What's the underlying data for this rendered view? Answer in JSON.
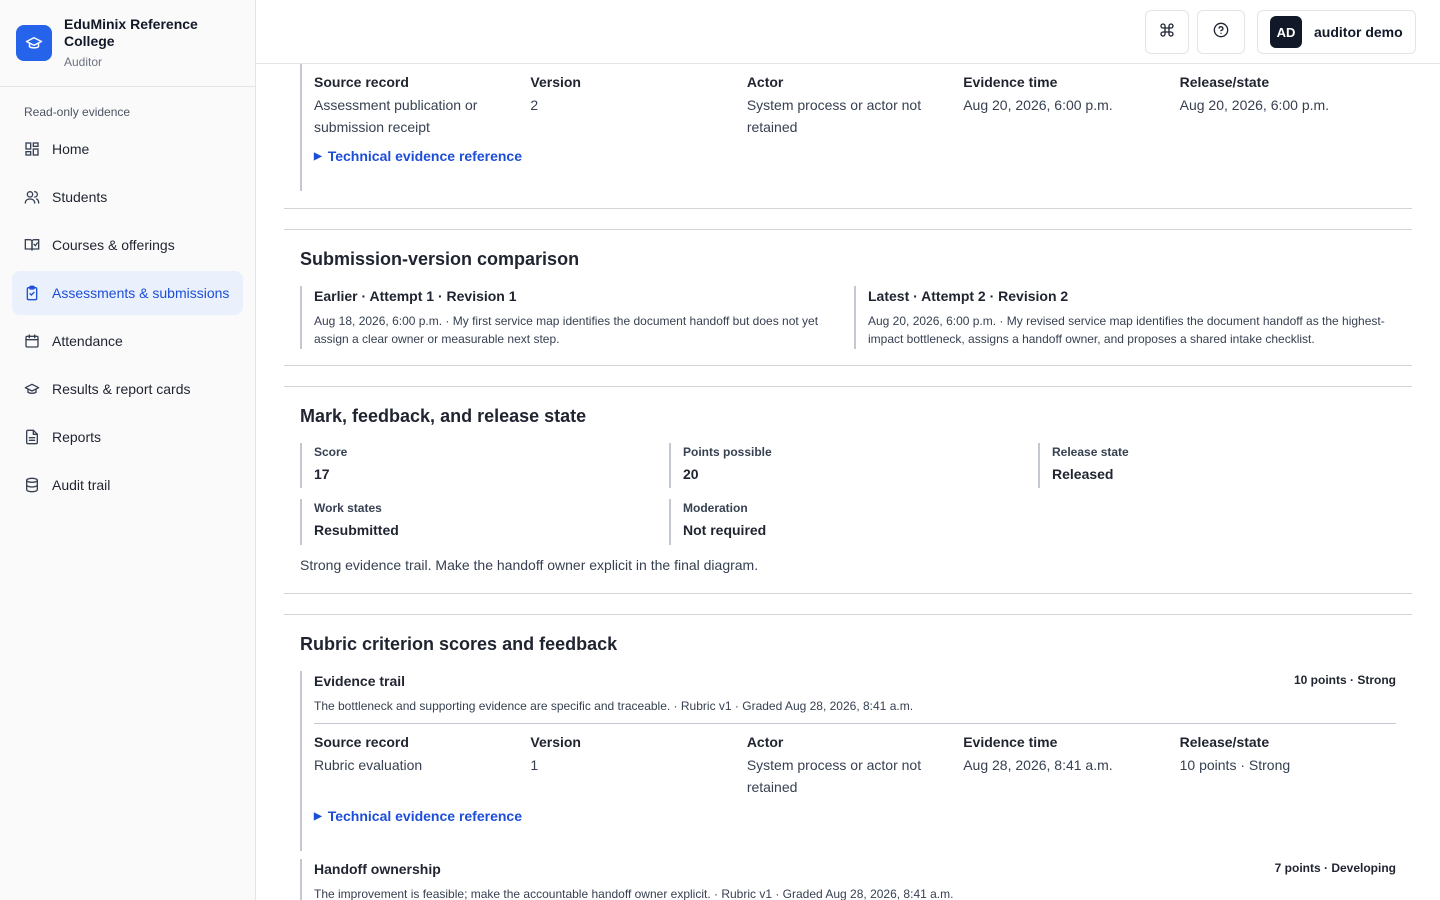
{
  "brand": {
    "name": "EduMinix Reference College",
    "role": "Auditor"
  },
  "sidebar": {
    "heading": "Read-only evidence",
    "items": [
      {
        "label": "Home",
        "icon": "dashboard-icon"
      },
      {
        "label": "Students",
        "icon": "users-icon"
      },
      {
        "label": "Courses & offerings",
        "icon": "book-check-icon"
      },
      {
        "label": "Assessments & submissions",
        "icon": "clipboard-check-icon",
        "active": true
      },
      {
        "label": "Attendance",
        "icon": "calendar-icon"
      },
      {
        "label": "Results & report cards",
        "icon": "graduation-cap-icon"
      },
      {
        "label": "Reports",
        "icon": "file-text-icon"
      },
      {
        "label": "Audit trail",
        "icon": "database-icon"
      }
    ]
  },
  "header": {
    "command_icon": "command-icon",
    "help_icon": "help-circle-icon",
    "user": {
      "initials": "AD",
      "name": "auditor demo"
    }
  },
  "publication_evidence": {
    "labels": [
      "Source record",
      "Version",
      "Actor",
      "Evidence time",
      "Release/state"
    ],
    "values": [
      "Assessment publication or submission receipt",
      "2",
      "System process or actor not retained",
      "Aug 20, 2026, 6:00 p.m.",
      "Aug 20, 2026, 6:00 p.m."
    ],
    "tech_ref": "Technical evidence reference"
  },
  "comparison": {
    "title": "Submission-version comparison",
    "earlier": {
      "title": "Earlier · Attempt 1 · Revision 1",
      "text": "Aug 18, 2026, 6:00 p.m. · My first service map identifies the document handoff but does not yet assign a clear owner or measurable next step."
    },
    "latest": {
      "title": "Latest · Attempt 2 · Revision 2",
      "text": "Aug 20, 2026, 6:00 p.m. · My revised service map identifies the document handoff as the highest-impact bottleneck, assigns a handoff owner, and proposes a shared intake checklist."
    }
  },
  "mark": {
    "title": "Mark, feedback, and release state",
    "score_label": "Score",
    "score": "17",
    "points_label": "Points possible",
    "points": "20",
    "release_label": "Release state",
    "release": "Released",
    "work_label": "Work states",
    "work": "Resubmitted",
    "moderation_label": "Moderation",
    "moderation": "Not required",
    "feedback": "Strong evidence trail. Make the handoff owner explicit in the final diagram."
  },
  "rubric": {
    "title": "Rubric criterion scores and feedback",
    "criteria": [
      {
        "name": "Evidence trail",
        "score": "10 points · Strong",
        "desc": "The bottleneck and supporting evidence are specific and traceable. · Rubric v1 · Graded Aug 28, 2026, 8:41 a.m.",
        "labels": [
          "Source record",
          "Version",
          "Actor",
          "Evidence time",
          "Release/state"
        ],
        "values": [
          "Rubric evaluation",
          "1",
          "System process or actor not retained",
          "Aug 28, 2026, 8:41 a.m.",
          "10 points · Strong"
        ],
        "tech_ref": "Technical evidence reference"
      },
      {
        "name": "Handoff ownership",
        "score": "7 points · Developing",
        "desc": "The improvement is feasible; make the accountable handoff owner explicit. · Rubric v1 · Graded Aug 28, 2026, 8:41 a.m."
      }
    ]
  }
}
